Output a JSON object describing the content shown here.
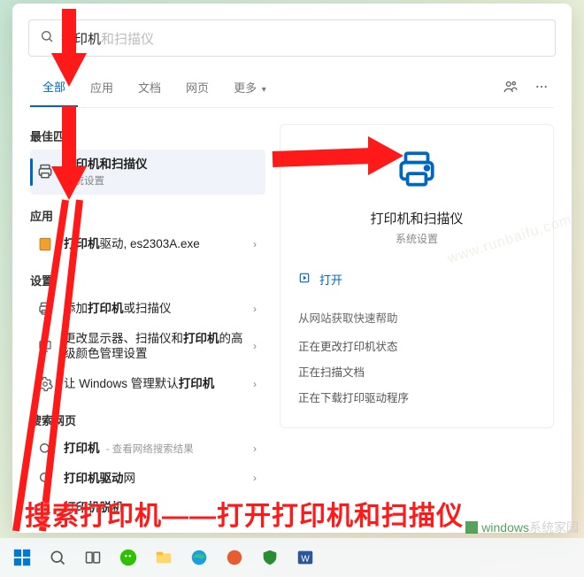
{
  "search": {
    "typed": "打印机",
    "ghost": "和扫描仪"
  },
  "tabs": {
    "items": [
      "全部",
      "应用",
      "文档",
      "网页",
      "更多"
    ],
    "chevron": "▾",
    "active_index": 0
  },
  "sections": {
    "best_match": "最佳匹配",
    "apps": "应用",
    "settings": "设置",
    "search_web": "搜索网页"
  },
  "best_match": {
    "title": "打印机和扫描仪",
    "subtitle": "系统设置"
  },
  "apps": [
    {
      "title_pre": "",
      "title_bold": "打印机",
      "title_post": "驱动, es2303A.exe"
    }
  ],
  "settings": [
    {
      "title_pre": "添加",
      "title_bold": "打印机",
      "title_post": "或扫描仪"
    },
    {
      "title_pre": "更改显示器、扫描仪和",
      "title_bold": "打印机",
      "title_post": "的高级颜色管理设置"
    },
    {
      "title_pre": "让 Windows 管理默认",
      "title_bold": "打印机",
      "title_post": ""
    }
  ],
  "web": [
    {
      "title_bold": "打印机",
      "title_post": "",
      "more": " - 查看网络搜索结果"
    },
    {
      "title_bold": "打印机驱动",
      "title_post": "网",
      "more": ""
    },
    {
      "title_bold": "打印机脱机",
      "title_post": "",
      "more": ""
    }
  ],
  "detail": {
    "title": "打印机和扫描仪",
    "subtitle": "系统设置",
    "open": "打开",
    "help_label": "从网站获取快速帮助",
    "links": [
      "正在更改打印机状态",
      "正在扫描文档",
      "正在下载打印驱动程序"
    ]
  },
  "caption": "搜索打印机——打开打印机和扫描仪",
  "watermark": {
    "brand": "windows",
    "suffix": "系统家园",
    "faint": "www.runbaifu.com"
  }
}
